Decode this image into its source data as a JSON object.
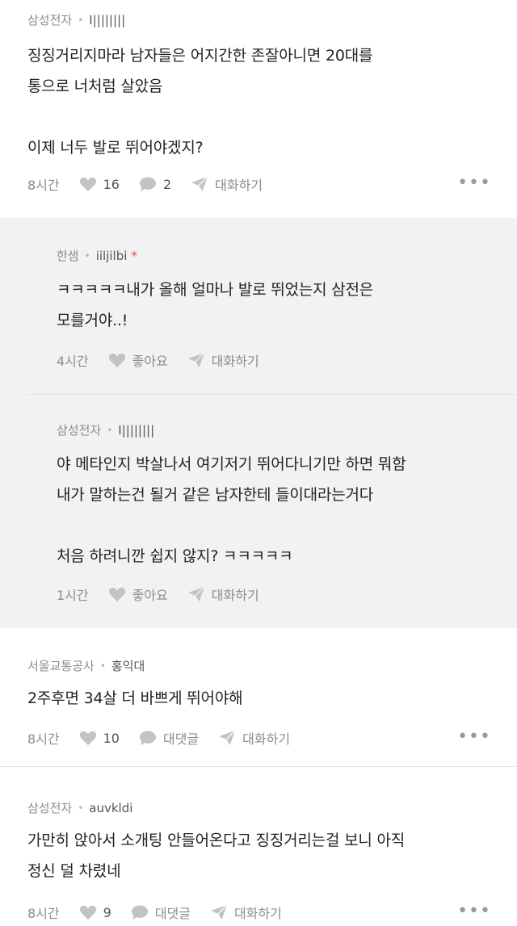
{
  "comments": [
    {
      "company": "삼성전자",
      "handle": "I||||||||",
      "lines": [
        "징징거리지마라 남자들은 어지간한 존잘아니면 20대를",
        "통으로 너처럼 살았음"
      ],
      "lines2": [
        "이제 너두 발로 뛰어야겠지?"
      ],
      "time": "8시간",
      "likes": "16",
      "replies": "2",
      "chat": "대화하기"
    },
    {
      "company": "한샘",
      "handle": "iiljilbi",
      "badge": "*",
      "lines": [
        "ㅋㅋㅋㅋㅋ내가 올해 얼마나 발로 뛰었는지 삼전은",
        "모를거야..!"
      ],
      "time": "4시간",
      "like_label": "좋아요",
      "chat": "대화하기"
    },
    {
      "company": "삼성전자",
      "handle": "I||||||||",
      "lines": [
        "야 메타인지 박살나서 여기저기 뛰어다니기만 하면 뭐함",
        "내가 말하는건 될거 같은 남자한테 들이대라는거다"
      ],
      "lines2": [
        "처음 하려니깐 쉽지 않지? ㅋㅋㅋㅋㅋ"
      ],
      "time": "1시간",
      "like_label": "좋아요",
      "chat": "대화하기"
    },
    {
      "company": "서울교통공사",
      "handle": "홍익대",
      "lines": [
        "2주후면 34살 더 바쁘게 뛰어야해"
      ],
      "time": "8시간",
      "likes": "10",
      "reply_label": "대댓글",
      "chat": "대화하기"
    },
    {
      "company": "삼성전자",
      "handle": "auvkldi",
      "lines": [
        "가만히 앉아서 소개팅 안들어온다고 징징거리는걸 보니 아직",
        "정신 덜 차렸네"
      ],
      "time": "8시간",
      "likes": "9",
      "reply_label": "대댓글",
      "chat": "대화하기"
    }
  ],
  "icons": {
    "like": "heart-icon",
    "reply": "speech-bubble-icon",
    "chat": "paper-plane-icon",
    "more": "more-dots-icon"
  },
  "more_label": "•••",
  "colors": {
    "reply_bg": "#f1f2f4",
    "meta": "#8c8c8c",
    "badge": "#e8453c"
  }
}
